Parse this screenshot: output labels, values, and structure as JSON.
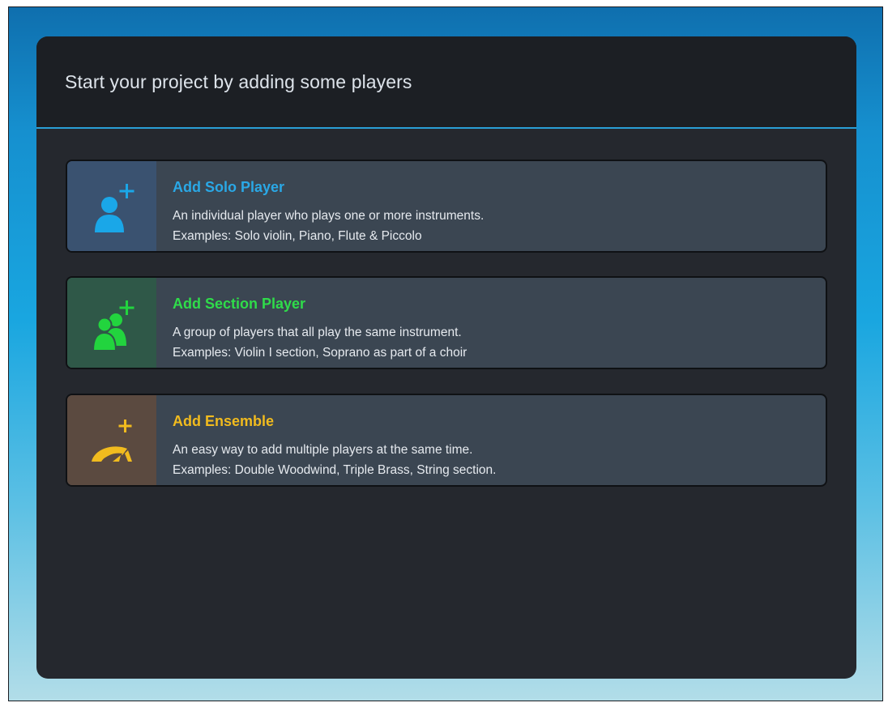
{
  "dialog": {
    "title": "Start your project by adding some players"
  },
  "options": [
    {
      "title": "Add Solo Player",
      "description": "An individual player who plays one or more instruments.",
      "examples": "Examples: Solo violin, Piano, Flute & Piccolo",
      "icon": "add-solo-player-icon",
      "color": "#2aa8e6"
    },
    {
      "title": "Add Section Player",
      "description": "A group of players that all play the same instrument.",
      "examples": "Examples: Violin I section, Soprano as part of a choir",
      "icon": "add-section-player-icon",
      "color": "#2fdc4a"
    },
    {
      "title": "Add Ensemble",
      "description": "An easy way to add multiple players at the same time.",
      "examples": "Examples: Double Woodwind, Triple Brass, String section.",
      "icon": "add-ensemble-icon",
      "color": "#f1bb1e"
    }
  ]
}
